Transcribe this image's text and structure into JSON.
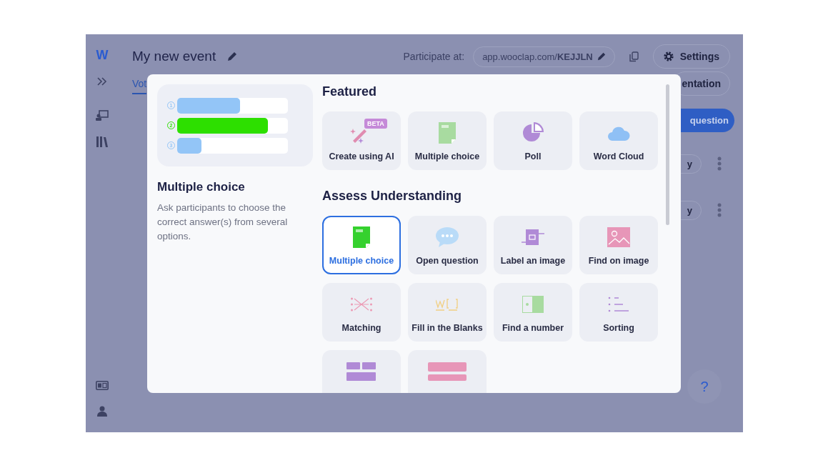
{
  "app": {
    "logo": "W",
    "title": "My new event",
    "participate_label": "Participate at:",
    "participate_url": "app.wooclap.com/**KEJJLN**",
    "settings": "Settings",
    "tab": "Vot",
    "presentation_button": "entation",
    "add_button": "question",
    "rows": [
      {
        "badge": "y"
      },
      {
        "badge": "y"
      }
    ],
    "help": "?"
  },
  "modal": {
    "preview": {
      "bars": [
        {
          "number": "1",
          "level": 0.57,
          "color": "#93c5f7"
        },
        {
          "number": "2",
          "level": 0.82,
          "color": "#2ddf00"
        },
        {
          "number": "3",
          "level": 0.22,
          "color": "#93c5f7"
        }
      ],
      "title": "Multiple choice",
      "description": "Ask participants to choose the correct answer(s) from several options."
    },
    "sections": [
      {
        "title": "Featured",
        "items": [
          {
            "kind": "ai",
            "label": "Create using AI",
            "badge": "BETA",
            "selected": false
          },
          {
            "kind": "mcq",
            "label": "Multiple choice",
            "selected": false
          },
          {
            "kind": "poll",
            "label": "Poll",
            "selected": false
          },
          {
            "kind": "cloud",
            "label": "Word Cloud",
            "selected": false
          }
        ]
      },
      {
        "title": "Assess Understanding",
        "items": [
          {
            "kind": "mcq",
            "label": "Multiple choice",
            "selected": true
          },
          {
            "kind": "open",
            "label": "Open question",
            "selected": false
          },
          {
            "kind": "label",
            "label": "Label an image",
            "selected": false
          },
          {
            "kind": "findimage",
            "label": "Find on image",
            "selected": false
          },
          {
            "kind": "matching",
            "label": "Matching",
            "selected": false
          },
          {
            "kind": "blanks",
            "label": "Fill in the Blanks",
            "selected": false
          },
          {
            "kind": "number",
            "label": "Find a number",
            "selected": false
          },
          {
            "kind": "sorting",
            "label": "Sorting",
            "selected": false
          },
          {
            "kind": "scalegrid",
            "selected": false
          },
          {
            "kind": "scale",
            "selected": false
          }
        ]
      }
    ]
  }
}
